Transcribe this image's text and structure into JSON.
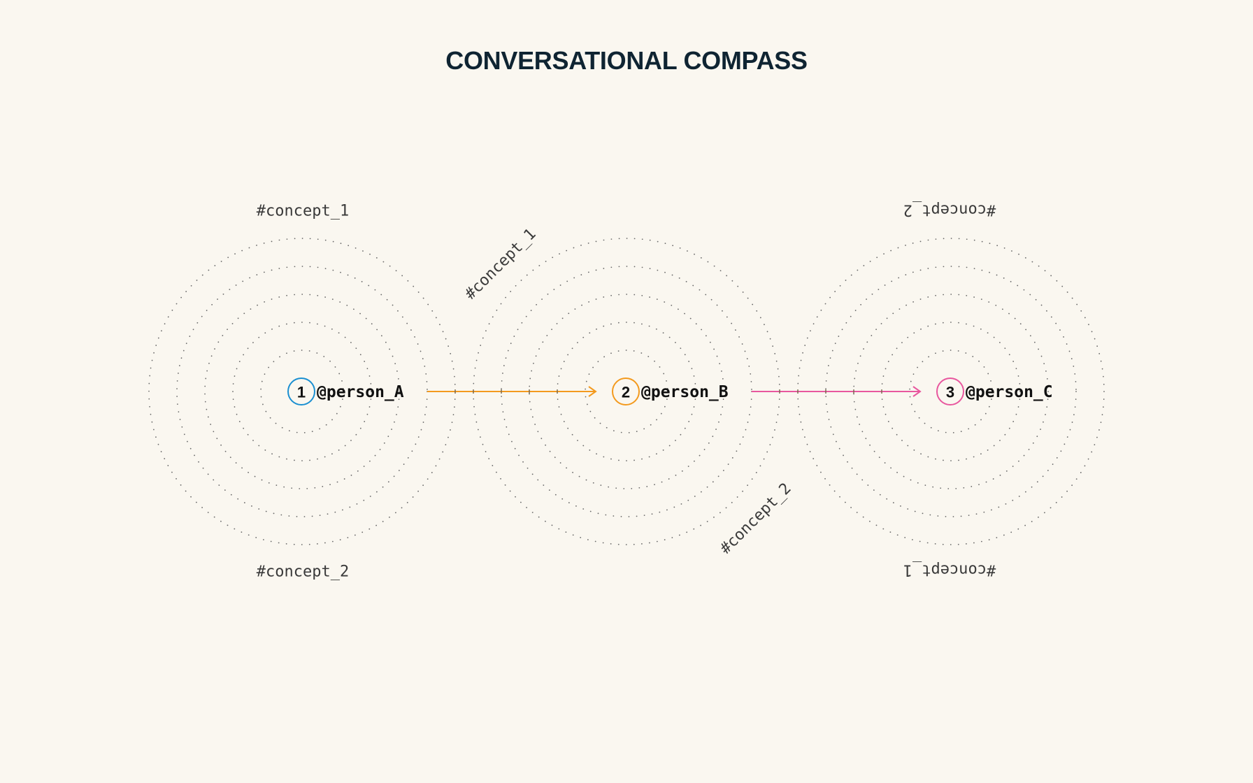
{
  "title": "CONVERSATIONAL COMPASS",
  "nodes": [
    {
      "number": "1",
      "label": "@person_A",
      "color": "#1a8fd1",
      "concept_top": "#concept_1",
      "concept_bottom": "#concept_2"
    },
    {
      "number": "2",
      "label": "@person_B",
      "color": "#f39a1e",
      "concept_top": "#concept_1",
      "concept_bottom": "#concept_2"
    },
    {
      "number": "3",
      "label": "@person_C",
      "color": "#e8579e",
      "concept_top": "#concept_2",
      "concept_bottom": "#concept_1"
    }
  ],
  "arrows": [
    {
      "from": "@person_A",
      "to": "@person_B",
      "color": "#f39a1e"
    },
    {
      "from": "@person_B",
      "to": "@person_C",
      "color": "#e8579e"
    }
  ]
}
